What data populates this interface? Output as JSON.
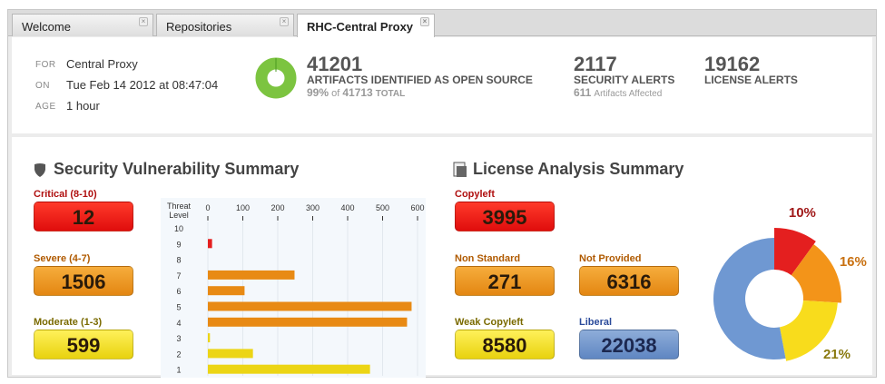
{
  "tabs": [
    {
      "label": "Welcome"
    },
    {
      "label": "Repositories"
    },
    {
      "label": "RHC-Central Proxy"
    }
  ],
  "meta": {
    "for_key": "FOR",
    "for_val": "Central Proxy",
    "on_key": "ON",
    "on_val": "Tue Feb 14 2012 at 08:47:04",
    "age_key": "AGE",
    "age_val": "1 hour"
  },
  "artifacts": {
    "count": "41201",
    "label": "ARTIFACTS IDENTIFIED AS OPEN SOURCE",
    "pct": "99%",
    "of": "of",
    "total": "41713",
    "total_label": "TOTAL",
    "fraction": 0.99
  },
  "security": {
    "count": "2117",
    "label": "SECURITY ALERTS",
    "affected": "611",
    "affected_label": "Artifacts Affected"
  },
  "license": {
    "count": "19162",
    "label": "LICENSE ALERTS"
  },
  "vuln": {
    "title": "Security Vulnerability Summary",
    "critical_label": "Critical (8-10)",
    "critical": "12",
    "severe_label": "Severe (4-7)",
    "severe": "1506",
    "moderate_label": "Moderate (1-3)",
    "moderate": "599"
  },
  "lic": {
    "title": "License Analysis Summary",
    "copyleft_label": "Copyleft",
    "copyleft": "3995",
    "nonstd_label": "Non Standard",
    "nonstd": "271",
    "notprov_label": "Not Provided",
    "notprov": "6316",
    "weak_label": "Weak Copyleft",
    "weak": "8580",
    "liberal_label": "Liberal",
    "liberal": "22038"
  },
  "colors": {
    "red": "#e41f1f",
    "orange": "#f39419",
    "yellow": "#f8dc1c",
    "blue": "#6f98d2",
    "green": "#7cc440"
  },
  "chart_data": [
    {
      "type": "bar",
      "orientation": "horizontal",
      "title": "",
      "ylabel": "Threat Level",
      "categories": [
        "10",
        "9",
        "8",
        "7",
        "6",
        "5",
        "4",
        "3",
        "2",
        "1"
      ],
      "values": [
        0,
        12,
        0,
        248,
        105,
        583,
        570,
        6,
        129,
        464
      ],
      "xlim": [
        0,
        600
      ],
      "xticks": [
        "0",
        "100",
        "200",
        "300",
        "400",
        "500",
        "600"
      ],
      "grid": true
    },
    {
      "type": "pie",
      "donut": true,
      "categories": [
        "Copyleft",
        "Non Standard + Not Provided",
        "Weak Copyleft",
        "Liberal"
      ],
      "values": [
        10,
        16,
        21,
        53
      ],
      "labels": [
        "10%",
        "16%",
        "21%",
        ""
      ]
    }
  ]
}
